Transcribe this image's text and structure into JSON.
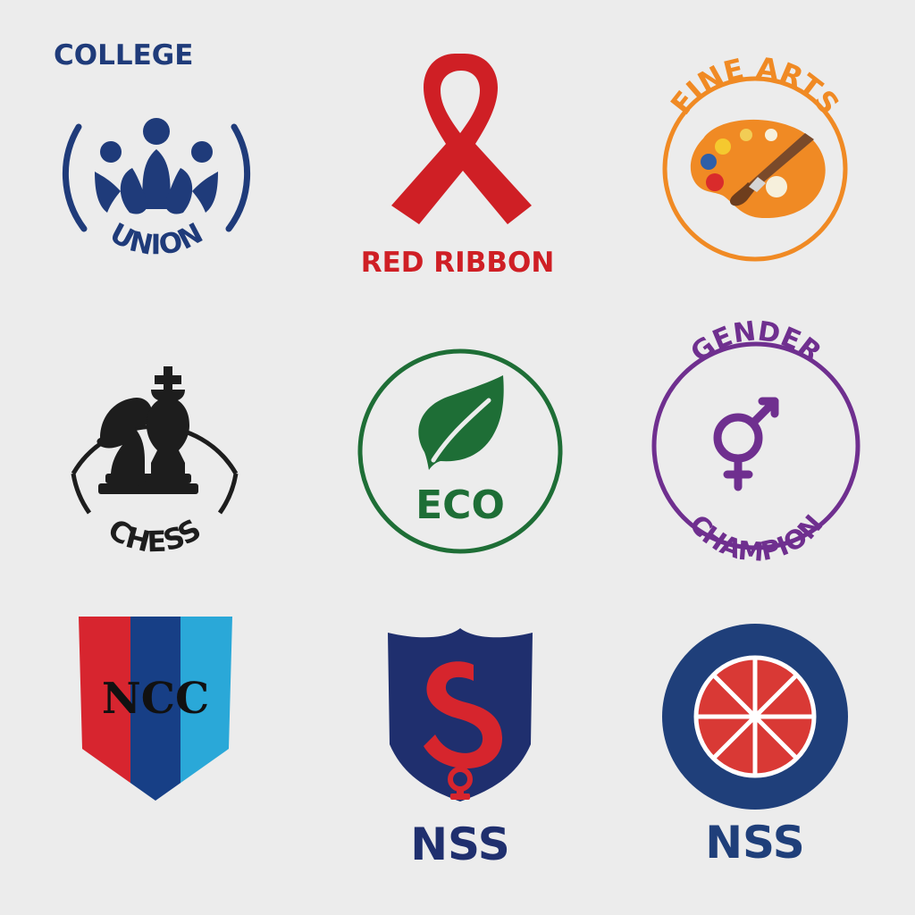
{
  "logos": {
    "college_union": {
      "top_text": "COLLEGE",
      "bottom_text": "UNION",
      "color": "#1f3b7a"
    },
    "red_ribbon": {
      "text": "RED RIBBON",
      "color": "#cf1f25"
    },
    "fine_arts": {
      "text": "FINE ARTS",
      "color": "#f08a24"
    },
    "chess": {
      "text": "CHESS",
      "color": "#1d1d1d"
    },
    "eco": {
      "text": "ECO",
      "color": "#1e6e36"
    },
    "gender_champion": {
      "top_text": "GENDER",
      "bottom_text": "CHAMPION",
      "color": "#6f2f8f"
    },
    "ncc": {
      "text": "NCC",
      "colors": [
        "#d7252f",
        "#173f86",
        "#2aa8d8"
      ]
    },
    "nss_shield": {
      "text": "NSS",
      "shield_color": "#1f2f6e",
      "symbol_color": "#d6252d"
    },
    "nss_wheel": {
      "text": "NSS",
      "outer_color": "#1f3f7a",
      "inner_color": "#d93935"
    }
  }
}
